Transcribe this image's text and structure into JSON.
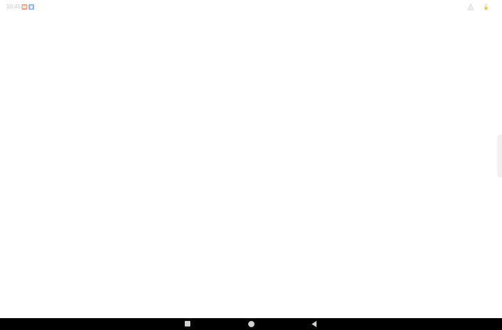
{
  "status_bar": {
    "time": "10:45",
    "notification_icons": [
      "orange-app-notification-icon",
      "blue-app-notification-icon"
    ],
    "signal_icon": "cell-signal-icon",
    "battery_icon": "battery-icon",
    "battery_level": 0.5
  },
  "edge_handle": {
    "icon": "edge-panel-handle"
  },
  "nav_bar": {
    "recents_icon": "square-recents-icon",
    "home_icon": "circle-home-icon",
    "back_icon": "triangle-back-icon"
  },
  "colors": {
    "background": "#ffffff",
    "status_text": "#c9c9c9",
    "nav_bar": "#000000",
    "nav_icons": "#d0d0d0",
    "battery_fill": "#f3c74b"
  }
}
